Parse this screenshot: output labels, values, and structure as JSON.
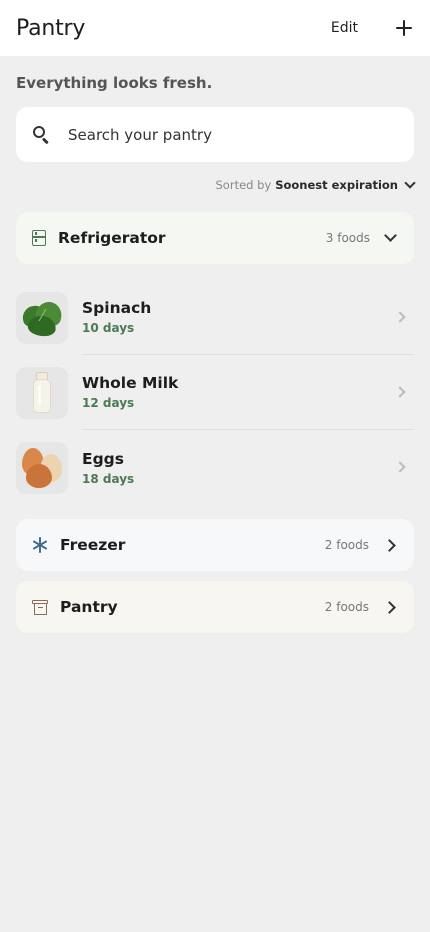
{
  "header": {
    "title": "Pantry",
    "edit_label": "Edit",
    "add_icon": "plus-icon"
  },
  "status_message": "Everything looks fresh.",
  "search": {
    "placeholder": "Search your pantry",
    "value": "",
    "icon": "search-icon"
  },
  "sort": {
    "prefix": "Sorted by",
    "value": "Soonest expiration",
    "icon": "chevron-down-icon"
  },
  "sections": [
    {
      "name": "Refrigerator",
      "count": "3 foods",
      "icon": "fridge-icon",
      "expanded": true,
      "tint": "#f5f7f3",
      "items": [
        {
          "name": "Spinach",
          "expiry": "10 days",
          "image": "spinach"
        },
        {
          "name": "Whole Milk",
          "expiry": "12 days",
          "image": "milk-bottle"
        },
        {
          "name": "Eggs",
          "expiry": "18 days",
          "image": "eggs"
        }
      ]
    },
    {
      "name": "Freezer",
      "count": "2 foods",
      "icon": "snowflake-icon",
      "expanded": false,
      "tint": "#f6f8fa"
    },
    {
      "name": "Pantry",
      "count": "2 foods",
      "icon": "box-icon",
      "expanded": false,
      "tint": "#f8f6f1"
    }
  ],
  "colors": {
    "fresh_green": "#4b7a52",
    "fridge_icon": "#4e7a56",
    "freezer_icon": "#3f6c8f",
    "pantry_icon": "#8a6a55"
  }
}
